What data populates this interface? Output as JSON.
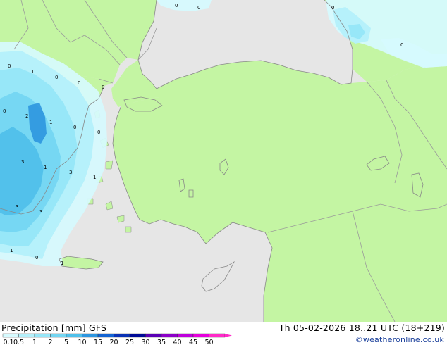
{
  "title": {
    "left": "Precipitation [mm] GFS",
    "right": "Th 05-02-2026 18..21 UTC (18+219)"
  },
  "copyright": "©weatheronline.co.uk",
  "colors": {
    "sea": "#e6e6e6",
    "land": "#c4f5a3",
    "border": "#9a9a9a",
    "coast": "#888888",
    "p01": "#d6fafe",
    "p05": "#b4f0fb",
    "p1": "#96e6f8",
    "p2": "#74d6f2",
    "p5": "#50c0ea",
    "p10": "#2e96df"
  },
  "legend": {
    "ticks": [
      "0.1",
      "0.5",
      "1",
      "2",
      "5",
      "10",
      "15",
      "20",
      "25",
      "30",
      "35",
      "40",
      "45",
      "50"
    ],
    "swatches": [
      "#d6fafe",
      "#b4f0fb",
      "#96e6f8",
      "#74d6f2",
      "#50c0ea",
      "#2e96df",
      "#1464d2",
      "#0a32b4",
      "#000a96",
      "#5a00b4",
      "#8c00c8",
      "#be00dc",
      "#e600dc",
      "#ff2ac8"
    ]
  },
  "labels": [
    {
      "text": "0"
    },
    {
      "text": "0"
    },
    {
      "text": "0"
    },
    {
      "text": "0"
    },
    {
      "text": "1"
    },
    {
      "text": "0"
    },
    {
      "text": "0"
    },
    {
      "text": "0"
    },
    {
      "text": "2"
    },
    {
      "text": "1"
    },
    {
      "text": "0"
    },
    {
      "text": "0"
    },
    {
      "text": "3"
    },
    {
      "text": "1"
    },
    {
      "text": "3"
    },
    {
      "text": "1"
    },
    {
      "text": "3"
    },
    {
      "text": "3"
    },
    {
      "text": "1"
    },
    {
      "text": "0"
    },
    {
      "text": "1"
    },
    {
      "text": "0"
    },
    {
      "text": "0"
    }
  ]
}
